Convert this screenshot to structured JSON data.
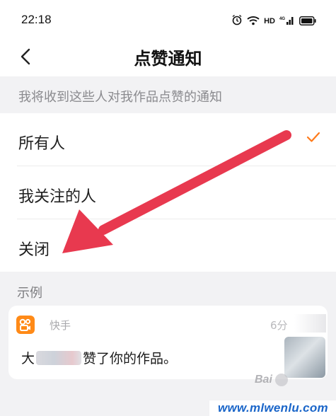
{
  "status_bar": {
    "time": "22:18",
    "hd_label": "HD",
    "network_label": "4G"
  },
  "header": {
    "title": "点赞通知"
  },
  "section": {
    "description": "我将收到这些人对我作品点赞的通知"
  },
  "options": [
    {
      "label": "所有人",
      "selected": true
    },
    {
      "label": "我关注的人",
      "selected": false
    },
    {
      "label": "关闭",
      "selected": false
    }
  ],
  "example": {
    "label": "示例",
    "app_name": "快手",
    "time": "6分",
    "message_prefix": "大",
    "message_suffix": "赞了你的作品。"
  },
  "watermark": {
    "text": "Bai",
    "site": "www.mlwenlu.com"
  },
  "colors": {
    "accent": "#ff6a00",
    "check": "#ff7a1a",
    "annotation_arrow": "#e8394f"
  }
}
